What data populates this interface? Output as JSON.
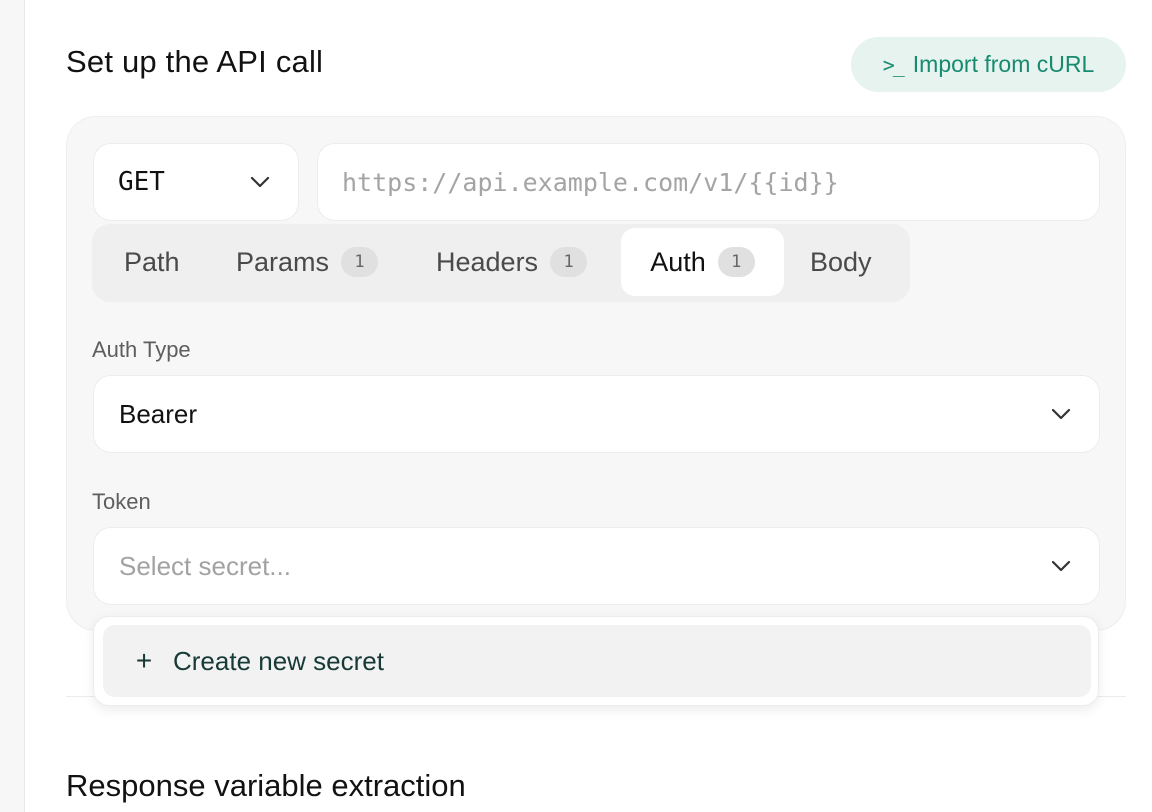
{
  "section": {
    "title": "Set up the API call",
    "import_label": "Import from cURL",
    "import_icon": "terminal-icon"
  },
  "request": {
    "method": "GET",
    "url_value": "",
    "url_placeholder": "https://api.example.com/v1/{{id}}"
  },
  "tabs": [
    {
      "label": "Path",
      "badge": null,
      "active": false
    },
    {
      "label": "Params",
      "badge": "1",
      "active": false
    },
    {
      "label": "Headers",
      "badge": "1",
      "active": false
    },
    {
      "label": "Auth",
      "badge": "1",
      "active": true
    },
    {
      "label": "Body",
      "badge": null,
      "active": false
    }
  ],
  "auth": {
    "type_label": "Auth Type",
    "type_value": "Bearer",
    "token_label": "Token",
    "token_placeholder": "Select secret..."
  },
  "dropdown": {
    "items": [
      {
        "icon": "plus-icon",
        "label": "Create new secret"
      }
    ]
  },
  "next_section": {
    "title": "Response variable extraction"
  },
  "colors": {
    "accent": "#178a70",
    "accent_bg": "#e6f3ef"
  }
}
